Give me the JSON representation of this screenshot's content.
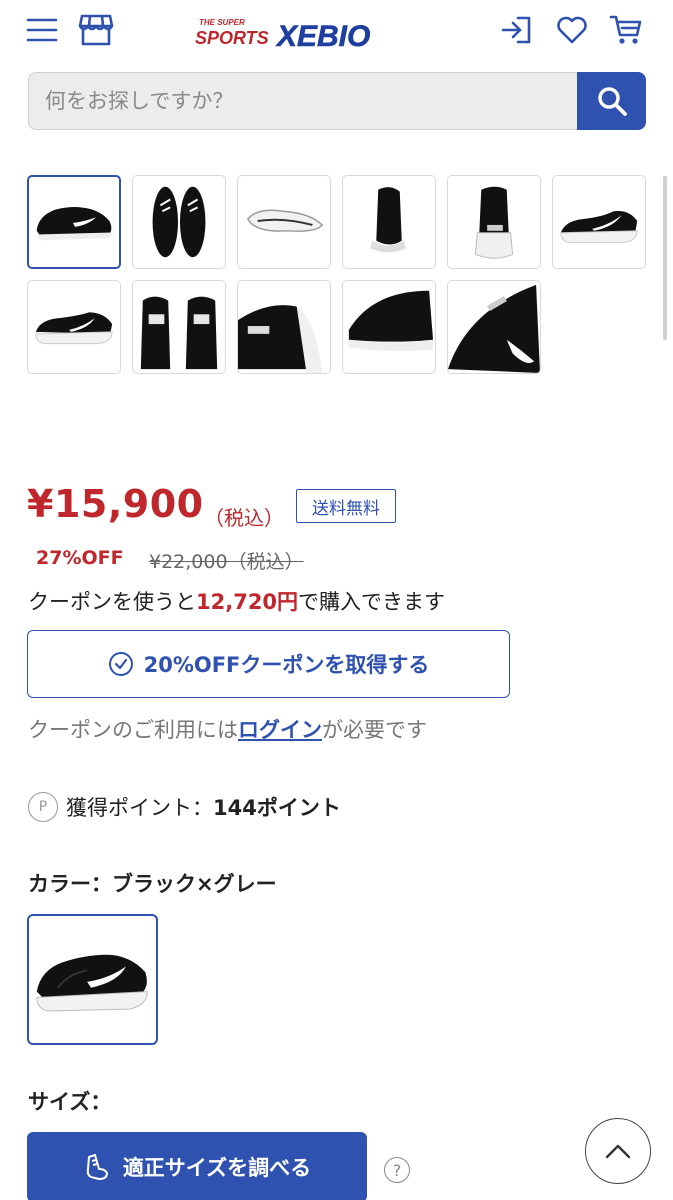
{
  "header": {
    "menu_icon": "hamburger-menu-icon",
    "store_icon": "store-icon",
    "logo_text_top": "THE SUPER",
    "logo_text_mid": "SPORTS",
    "logo_text_main": "XEBIO",
    "login_icon": "login-icon",
    "favorite_icon": "heart-icon",
    "cart_icon": "cart-icon"
  },
  "search": {
    "placeholder": "何をお探しですか？",
    "button_icon": "search-icon"
  },
  "gallery": {
    "thumbnail_count": 11,
    "selected_index": 0
  },
  "price": {
    "amount": "¥15,900",
    "tax_label": "（税込）",
    "free_shipping": "送料無料",
    "discount": "27%OFF",
    "original": "¥22,000（税込）"
  },
  "coupon": {
    "line_prefix": "クーポンを使うと",
    "line_amount": "12,720円",
    "line_suffix": "で購入できます",
    "button_label": "20%OFFクーポンを取得する",
    "note_prefix": "クーポンのご利用には",
    "note_link": "ログイン",
    "note_suffix": "が必要です"
  },
  "points": {
    "icon_letter": "P",
    "label": "獲得ポイント：",
    "value": "144ポイント"
  },
  "color": {
    "label": "カラー：ブラック×グレー"
  },
  "size": {
    "label": "サイズ：",
    "button_label": "適正サイズを調べる",
    "help_glyph": "?"
  },
  "colors": {
    "accent": "#2f51b0",
    "price_red": "#c0272d"
  }
}
